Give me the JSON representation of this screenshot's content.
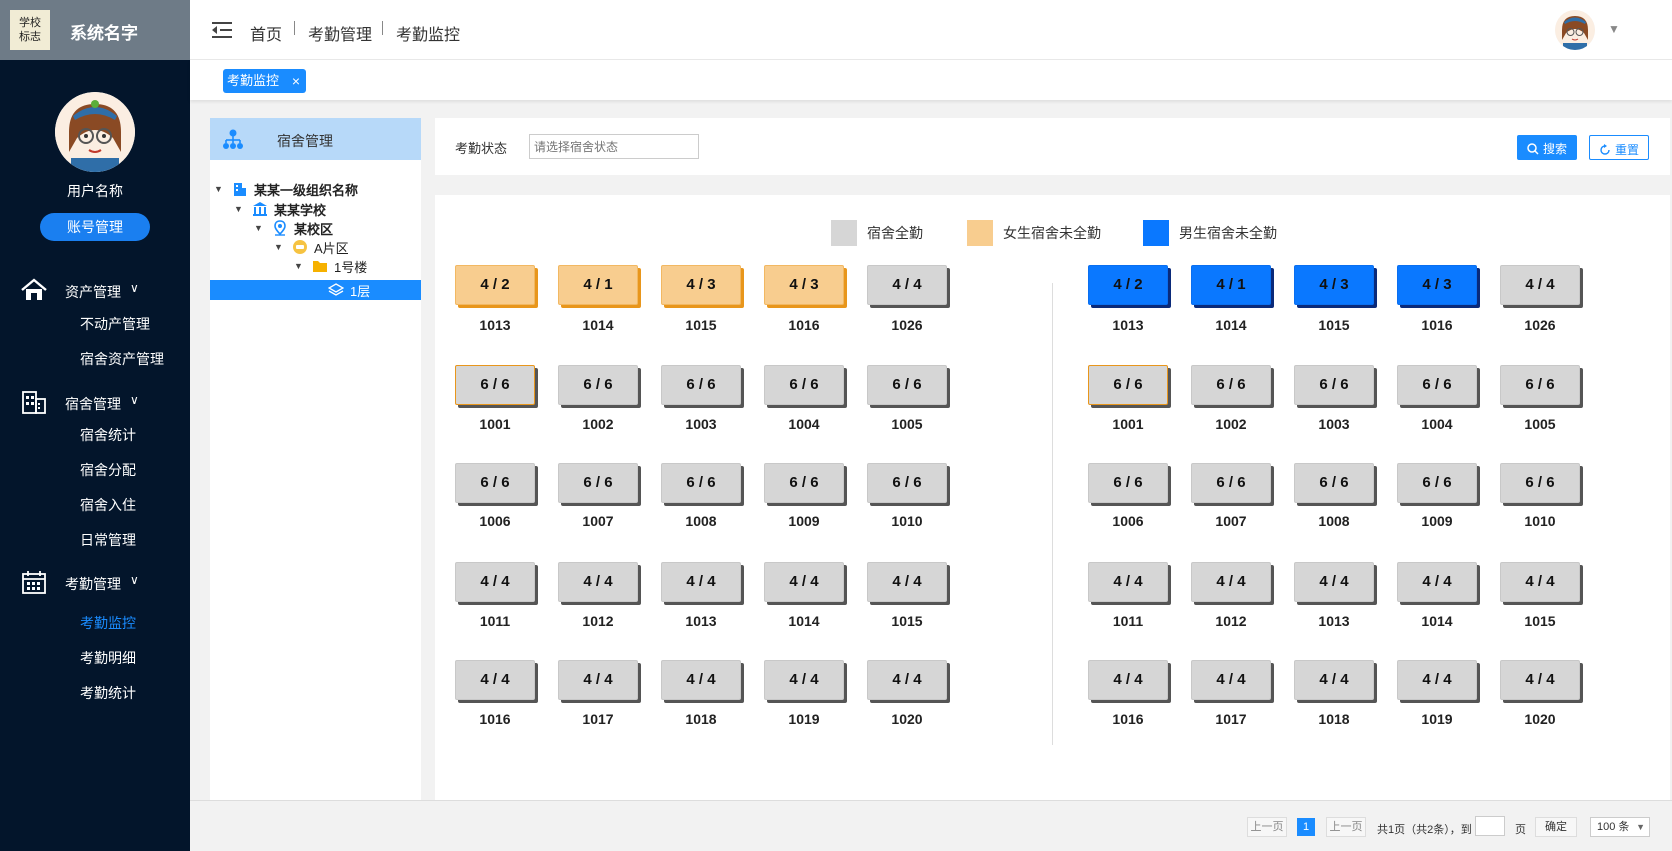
{
  "sidebar": {
    "logo_text": [
      "学校",
      "标志"
    ],
    "system_name": "系统名字",
    "user_name": "用户名称",
    "account_button": "账号管理",
    "groups": [
      {
        "label": "资产管理",
        "icon": "home-icon",
        "items": [
          "不动产管理",
          "宿舍资产管理"
        ]
      },
      {
        "label": "宿舍管理",
        "icon": "building-icon",
        "items": [
          "宿舍统计",
          "宿舍分配",
          "宿舍入住",
          "日常管理"
        ]
      },
      {
        "label": "考勤管理",
        "icon": "calendar-icon",
        "items": [
          "考勤监控",
          "考勤明细",
          "考勤统计"
        ]
      }
    ],
    "active_item": "考勤监控",
    "chevron": "∨"
  },
  "topbar": {
    "breadcrumbs": [
      "首页",
      "考勤管理",
      "考勤监控"
    ]
  },
  "tabs": {
    "active_label": "考勤监控",
    "close_glyph": "×"
  },
  "tree": {
    "header": "宿舍管理",
    "nodes": [
      {
        "label": "某某一级组织名称",
        "level": 0,
        "icon": "org-icon"
      },
      {
        "label": "某某学校",
        "level": 1,
        "icon": "school-icon"
      },
      {
        "label": "某校区",
        "level": 2,
        "icon": "location-icon"
      },
      {
        "label": "A片区",
        "level": 3,
        "icon": "area-icon"
      },
      {
        "label": "1号楼",
        "level": 4,
        "icon": "folder-icon"
      },
      {
        "label": "1层",
        "level": 5,
        "icon": "layers-icon",
        "selected": true
      }
    ]
  },
  "filter": {
    "label": "考勤状态",
    "placeholder": "请选择宿舍状态",
    "search_label": "搜索",
    "reset_label": "重置"
  },
  "legend": [
    {
      "label": "宿舍全勤",
      "color": "#d6d6d6"
    },
    {
      "label": "女生宿舍未全勤",
      "color": "#f8cd8f"
    },
    {
      "label": "男生宿舍未全勤",
      "color": "#0a78ff"
    }
  ],
  "rooms": {
    "left": [
      [
        {
          "v": "4 / 2",
          "n": "1013",
          "s": "orange"
        },
        {
          "v": "4 / 1",
          "n": "1014",
          "s": "orange"
        },
        {
          "v": "4 / 3",
          "n": "1015",
          "s": "orange"
        },
        {
          "v": "4 / 3",
          "n": "1016",
          "s": "orange"
        },
        {
          "v": "4 / 4",
          "n": "1026",
          "s": "gray"
        }
      ],
      [
        {
          "v": "6 / 6",
          "n": "1001",
          "s": "gray",
          "hl": true
        },
        {
          "v": "6 / 6",
          "n": "1002",
          "s": "gray"
        },
        {
          "v": "6 / 6",
          "n": "1003",
          "s": "gray"
        },
        {
          "v": "6 / 6",
          "n": "1004",
          "s": "gray"
        },
        {
          "v": "6 / 6",
          "n": "1005",
          "s": "gray"
        }
      ],
      [
        {
          "v": "6 / 6",
          "n": "1006",
          "s": "gray"
        },
        {
          "v": "6 / 6",
          "n": "1007",
          "s": "gray"
        },
        {
          "v": "6 / 6",
          "n": "1008",
          "s": "gray"
        },
        {
          "v": "6 / 6",
          "n": "1009",
          "s": "gray"
        },
        {
          "v": "6 / 6",
          "n": "1010",
          "s": "gray"
        }
      ],
      [
        {
          "v": "4 / 4",
          "n": "1011",
          "s": "gray"
        },
        {
          "v": "4 / 4",
          "n": "1012",
          "s": "gray"
        },
        {
          "v": "4 / 4",
          "n": "1013",
          "s": "gray"
        },
        {
          "v": "4 / 4",
          "n": "1014",
          "s": "gray"
        },
        {
          "v": "4 / 4",
          "n": "1015",
          "s": "gray"
        }
      ],
      [
        {
          "v": "4 / 4",
          "n": "1016",
          "s": "gray"
        },
        {
          "v": "4 / 4",
          "n": "1017",
          "s": "gray"
        },
        {
          "v": "4 / 4",
          "n": "1018",
          "s": "gray"
        },
        {
          "v": "4 / 4",
          "n": "1019",
          "s": "gray"
        },
        {
          "v": "4 / 4",
          "n": "1020",
          "s": "gray"
        }
      ]
    ],
    "right": [
      [
        {
          "v": "4 / 2",
          "n": "1013",
          "s": "blue"
        },
        {
          "v": "4 / 1",
          "n": "1014",
          "s": "blue"
        },
        {
          "v": "4 / 3",
          "n": "1015",
          "s": "blue"
        },
        {
          "v": "4 / 3",
          "n": "1016",
          "s": "blue"
        },
        {
          "v": "4 / 4",
          "n": "1026",
          "s": "gray"
        }
      ],
      [
        {
          "v": "6 / 6",
          "n": "1001",
          "s": "gray",
          "hl": true
        },
        {
          "v": "6 / 6",
          "n": "1002",
          "s": "gray"
        },
        {
          "v": "6 / 6",
          "n": "1003",
          "s": "gray"
        },
        {
          "v": "6 / 6",
          "n": "1004",
          "s": "gray"
        },
        {
          "v": "6 / 6",
          "n": "1005",
          "s": "gray"
        }
      ],
      [
        {
          "v": "6 / 6",
          "n": "1006",
          "s": "gray"
        },
        {
          "v": "6 / 6",
          "n": "1007",
          "s": "gray"
        },
        {
          "v": "6 / 6",
          "n": "1008",
          "s": "gray"
        },
        {
          "v": "6 / 6",
          "n": "1009",
          "s": "gray"
        },
        {
          "v": "6 / 6",
          "n": "1010",
          "s": "gray"
        }
      ],
      [
        {
          "v": "4 / 4",
          "n": "1011",
          "s": "gray"
        },
        {
          "v": "4 / 4",
          "n": "1012",
          "s": "gray"
        },
        {
          "v": "4 / 4",
          "n": "1013",
          "s": "gray"
        },
        {
          "v": "4 / 4",
          "n": "1014",
          "s": "gray"
        },
        {
          "v": "4 / 4",
          "n": "1015",
          "s": "gray"
        }
      ],
      [
        {
          "v": "4 / 4",
          "n": "1016",
          "s": "gray"
        },
        {
          "v": "4 / 4",
          "n": "1017",
          "s": "gray"
        },
        {
          "v": "4 / 4",
          "n": "1018",
          "s": "gray"
        },
        {
          "v": "4 / 4",
          "n": "1019",
          "s": "gray"
        },
        {
          "v": "4 / 4",
          "n": "1020",
          "s": "gray"
        }
      ]
    ]
  },
  "pager": {
    "prev": "上一页",
    "current": "1",
    "next": "上一页",
    "summary": "共1页（共2条），到",
    "page_unit": "页",
    "confirm": "确定",
    "page_size": "100 条"
  }
}
